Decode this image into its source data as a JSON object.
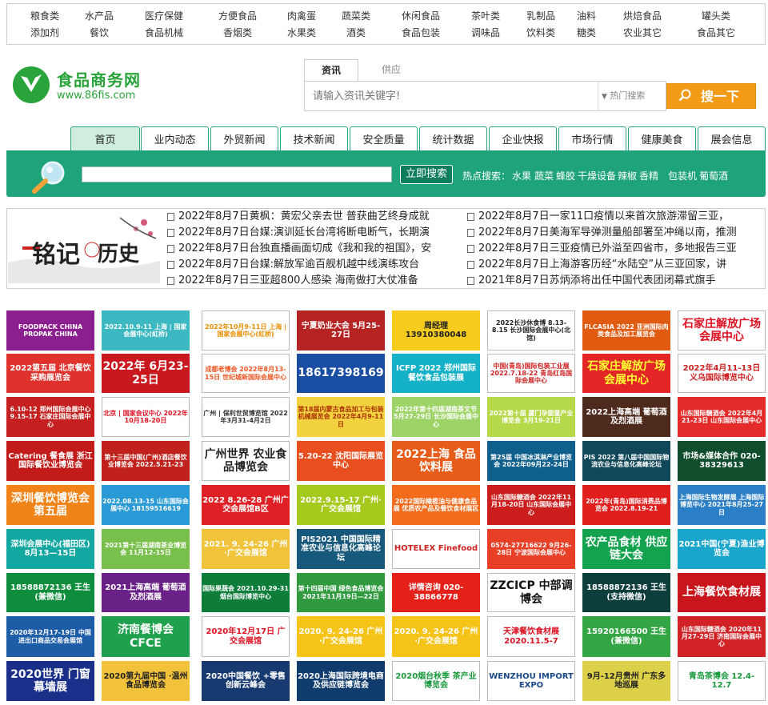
{
  "top_categories": [
    [
      "粮食类",
      "水产品",
      "医疗保健",
      "方便食品",
      "肉禽蛋",
      "蔬菜类",
      "休闲食品",
      "茶叶类",
      "乳制品",
      "油料",
      "烘焙食品",
      "罐头类"
    ],
    [
      "添加剂",
      "餐饮",
      "食品机械",
      "香烟类",
      "水果类",
      "酒类",
      "食品包装",
      "调味品",
      "饮料类",
      "糖类",
      "农业其它",
      "食品其它"
    ]
  ],
  "logo": {
    "name": "食品商务网",
    "url": "www.86fis.com"
  },
  "search": {
    "tabs": [
      "资讯",
      "供应"
    ],
    "placeholder": "请输入资讯关键字!",
    "hot_dropdown": "热门搜索",
    "button": "搜一下"
  },
  "nav_tabs": [
    "首页",
    "业内动态",
    "外贸新闻",
    "技术新闻",
    "安全质量",
    "统计数据",
    "企业快报",
    "市场行情",
    "健康美食",
    "展会信息"
  ],
  "green_search": {
    "button": "立即搜索",
    "hot_label": "热点搜索：",
    "hot_words": [
      "水果",
      "蔬菜",
      "蜂胶",
      "干燥设备",
      "辣椒",
      "香精",
      "包装机",
      "葡萄酒"
    ]
  },
  "news_image_text": "铭记历史",
  "news_left": [
    "2022年8月7日黄枫：黄宏父亲去世 普获曲艺终身成就",
    "2022年8月7日台媒:演训延长台湾将断电断气，长期演",
    "2022年8月7日台独直播画面切成《我和我的祖国》，安",
    "2022年8月7日台媒:解放军逾百舰机越中线演练攻台",
    "2022年8月7日三亚超800人感染 海南做打大仗准备"
  ],
  "news_right": [
    "2022年8月7日一家11口疫情以来首次旅游滞留三亚，",
    "2022年8月7日美海军导弹测量船部署至冲绳以南，推测",
    "2022年8月7日三亚疫情已外溢至四省市，多地报告三亚",
    "2022年8月7日上海游客历经“水陆空”从三亚回家，讲",
    "2021年8月7日苏炳添将出任中国代表团闭幕式旗手"
  ],
  "ads": [
    [
      "FOODPACK CHINA PROPAK CHINA",
      "2022.10.9-11 上海 | 国家会展中心(虹桥)",
      "2022年10月9-11日 上海 | 国家会展中心(虹桥)",
      "宁夏奶业大会 5月25-27日",
      "周经理 13910380048",
      "2022长沙休食博 8.13-8.15 长沙国际会展中心(北馆)",
      "FLCASIA 2022 亚洲国际肉类食品及加工展览会",
      "石家庄解放广场会展中心"
    ],
    [
      "2022第五届 北京餐饮采购展览会",
      "2022年 6月23-25日",
      "成都老博会 2022年8月13-15日 世纪城新国际会展中心",
      "18617398169",
      "ICFP 2022 郑州国际餐饮食品包装展",
      "中国(青岛)国际包装工业展 2022.7.18-22 青岛红岛国际会展中心",
      "石家庄解放广场 会展中心",
      "2022年4月11-13日 义乌国际博览中心"
    ],
    [
      "6.10-12 郑州国际会展中心 9.15-17 石家庄国际会展中心",
      "北京 | 国家会议中心 2022年10月18-20日",
      "广州 | 保利世贸博览馆 2022年3月31-4月2日",
      "第18届内蒙古食品加工与包装机械展览会 2022年4月9-11日",
      "2022年第十四届湖南茶文节 5月27-29日 长沙国际会展中心",
      "2022第十届 厦门孕婴童产业博览会 3月19-21日",
      "2022上海高端 葡萄酒及烈酒展",
      "山东国际糖酒会 2022年4月21-23日 山东国际会展中心"
    ],
    [
      "Catering 餐食展 浙江国际餐饮业博览会",
      "第十三届中国(广州)酒店餐饮业博览会 2022.5.21-23",
      "广州世界 农业食品博览会",
      "5.20-22 沈阳国际展览中心",
      "2022上海 食品饮料展",
      "第25届 中国冰淇淋产业博览会 2022年09月22-24日",
      "PIS 2022 第八届中国国际物流农业与信息化高峰论坛",
      "市场&媒体合作 020-38329613"
    ],
    [
      "深圳餐饮博览会 第五届",
      "2022.08.13-15 山东国际会展中心 18159516619",
      "2022 8.26-28 广州广交会展馆B区",
      "2022.9.15-17 广州·广交会展馆",
      "2022国际橄榄油与健康食品展 优质农产品及餐饮食材展区",
      "山东国际糖酒会 2022年11月18-20日 山东国际会展中心",
      "2022年(青岛)国际消费品博览会 2022.8.19-21",
      "上海国际生物发酵展 上海国际博览中心 2021年8月25-27日"
    ],
    [
      "深圳会展中心(福田区) 8月13—15日",
      "2021第十三届湖南茶业博览会 11月12-15日",
      "2021. 9. 24-26 广州·广交会展馆",
      "PIS2021 中国国际精准农业与信息化高峰论坛",
      "HOTELEX Finefood",
      "0574-27716622 9月26-28日 宁波国际会展中心",
      "农产品食材 供应链大会",
      "2021中国(宁夏)渔业博览会"
    ],
    [
      "18588872136 王生(兼微信)",
      "2021上海高端 葡萄酒及烈酒展",
      "国际果蔬会 2021.10.29-31 烟台国际博览中心",
      "第十四届中国 绿色食品博览会 2021年11月19日—22日",
      "详情咨询 020-38866778",
      "ZZCICP 中部调博会",
      "18588872136 王生(支持微信)",
      "上海餐饮食材展"
    ],
    [
      "2020年12月17-19日 中国进出口商品交易会展馆",
      "济南餐博会 CFCE",
      "2020年12月17日 广交会展馆",
      "2020. 9. 24-26 广州·广交会展馆",
      "2020. 9. 24-26 广州·广交会展馆",
      "天津餐饮食材展 2020.11.5-7",
      "15920166500 王生(兼微信)",
      "山东国际糖酒会 2020年11月27-29日 济南国际会展中心"
    ],
    [
      "2020世界 门窗幕墙展",
      "2020第九届中国 ·温州食品博览会",
      "2020中国餐饮 +零售创新云峰会",
      "2020上海国际跨境电商 及供应链博览会",
      "2020烟台秋季 茶产业博览会",
      "WENZHOU IMPORT EXPO",
      "9月-12月贵州 广东多地巡展",
      "青岛茶博会 12.4-12.7"
    ]
  ],
  "ad_colors": [
    [
      "#8c1f8f",
      "#3bb8c1",
      "#fff",
      "#b52323",
      "#f6cc1d",
      "#fff",
      "#e05a10",
      "#fff"
    ],
    [
      "#e0322c",
      "#c9181e",
      "#fff",
      "#1a4ea3",
      "#14b1c9",
      "#fff",
      "#e42525",
      "#fff"
    ],
    [
      "#c5201f",
      "#fff",
      "#fff",
      "#f3d23f",
      "#9ed367",
      "#b5d949",
      "#4d2a1c",
      "#e52a2a"
    ],
    [
      "#c31a1a",
      "#c0211b",
      "#fff",
      "#e94e1e",
      "#e65c18",
      "#0f5f8c",
      "#10485a",
      "#0f4d2c"
    ],
    [
      "#f18419",
      "#2a9ad6",
      "#df2024",
      "#a6c91e",
      "#f36b1d",
      "#cc1d1d",
      "#e11e1e",
      "#2b7fc6"
    ],
    [
      "#13a7a2",
      "#78c04b",
      "#f0c33a",
      "#17597d",
      "#fff",
      "#e83f27",
      "#13a34f",
      "#1aa5cc"
    ],
    [
      "#0e8d3c",
      "#6a2187",
      "#0e7d3a",
      "#2f9a3e",
      "#e42019",
      "#fff",
      "#0e3e3c",
      "#c9151c"
    ],
    [
      "#1d5da8",
      "#1fa04c",
      "#fff",
      "#f6c319",
      "#f6c319",
      "#fff",
      "#33a544",
      "#d12226"
    ],
    [
      "#1a2f8a",
      "#f2c33a",
      "#163a6f",
      "#0f3c6d",
      "#fff",
      "#fff",
      "#ddd14a",
      "#fff"
    ]
  ],
  "ad_text_colors": [
    [
      "#fff",
      "#fff",
      "#e88f00",
      "#fff",
      "#222",
      "#222",
      "#fff",
      "#d12"
    ],
    [
      "#fff",
      "#fff",
      "#e52",
      "#fff",
      "#fff",
      "#c22",
      "#ff3",
      "#c22"
    ],
    [
      "#fff",
      "#d12",
      "#333",
      "#a30",
      "#fff",
      "#fff",
      "#fff",
      "#fff"
    ],
    [
      "#fff",
      "#fff",
      "#222",
      "#fff",
      "#fff",
      "#fff",
      "#fff",
      "#fff"
    ],
    [
      "#fff",
      "#fff",
      "#fff",
      "#fff",
      "#fff",
      "#fff",
      "#fff",
      "#fff"
    ],
    [
      "#fff",
      "#fff",
      "#fff",
      "#fff",
      "#c22",
      "#fff",
      "#fff",
      "#fff"
    ],
    [
      "#fff",
      "#fff",
      "#fff",
      "#fff",
      "#fff",
      "#111",
      "#fff",
      "#fff"
    ],
    [
      "#fff",
      "#fff",
      "#d12",
      "#fff",
      "#fff",
      "#d12",
      "#fff",
      "#fff"
    ],
    [
      "#fff",
      "#222",
      "#fff",
      "#fff",
      "#1a9a3e",
      "#1b4b8a",
      "#222",
      "#1a9a3e"
    ]
  ]
}
